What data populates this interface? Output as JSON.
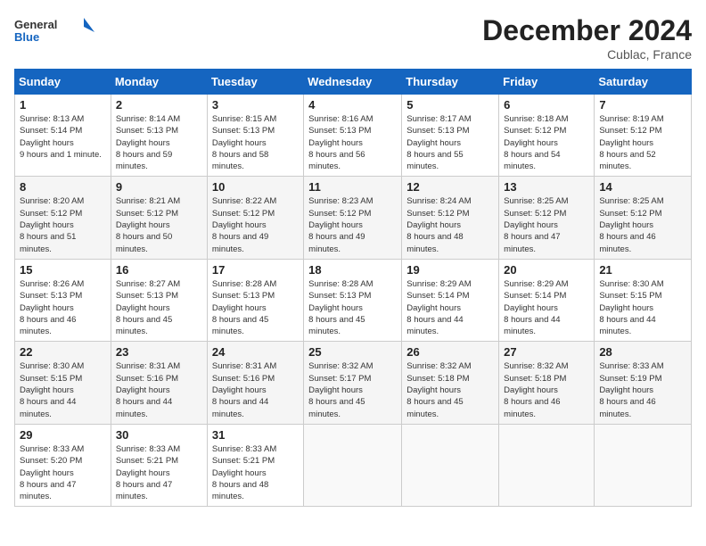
{
  "header": {
    "logo_line1": "General",
    "logo_line2": "Blue",
    "month_title": "December 2024",
    "location": "Cublac, France"
  },
  "weekdays": [
    "Sunday",
    "Monday",
    "Tuesday",
    "Wednesday",
    "Thursday",
    "Friday",
    "Saturday"
  ],
  "weeks": [
    [
      {
        "day": "1",
        "sunrise": "8:13 AM",
        "sunset": "5:14 PM",
        "daylight": "9 hours and 1 minute."
      },
      {
        "day": "2",
        "sunrise": "8:14 AM",
        "sunset": "5:13 PM",
        "daylight": "8 hours and 59 minutes."
      },
      {
        "day": "3",
        "sunrise": "8:15 AM",
        "sunset": "5:13 PM",
        "daylight": "8 hours and 58 minutes."
      },
      {
        "day": "4",
        "sunrise": "8:16 AM",
        "sunset": "5:13 PM",
        "daylight": "8 hours and 56 minutes."
      },
      {
        "day": "5",
        "sunrise": "8:17 AM",
        "sunset": "5:13 PM",
        "daylight": "8 hours and 55 minutes."
      },
      {
        "day": "6",
        "sunrise": "8:18 AM",
        "sunset": "5:12 PM",
        "daylight": "8 hours and 54 minutes."
      },
      {
        "day": "7",
        "sunrise": "8:19 AM",
        "sunset": "5:12 PM",
        "daylight": "8 hours and 52 minutes."
      }
    ],
    [
      {
        "day": "8",
        "sunrise": "8:20 AM",
        "sunset": "5:12 PM",
        "daylight": "8 hours and 51 minutes."
      },
      {
        "day": "9",
        "sunrise": "8:21 AM",
        "sunset": "5:12 PM",
        "daylight": "8 hours and 50 minutes."
      },
      {
        "day": "10",
        "sunrise": "8:22 AM",
        "sunset": "5:12 PM",
        "daylight": "8 hours and 49 minutes."
      },
      {
        "day": "11",
        "sunrise": "8:23 AM",
        "sunset": "5:12 PM",
        "daylight": "8 hours and 49 minutes."
      },
      {
        "day": "12",
        "sunrise": "8:24 AM",
        "sunset": "5:12 PM",
        "daylight": "8 hours and 48 minutes."
      },
      {
        "day": "13",
        "sunrise": "8:25 AM",
        "sunset": "5:12 PM",
        "daylight": "8 hours and 47 minutes."
      },
      {
        "day": "14",
        "sunrise": "8:25 AM",
        "sunset": "5:12 PM",
        "daylight": "8 hours and 46 minutes."
      }
    ],
    [
      {
        "day": "15",
        "sunrise": "8:26 AM",
        "sunset": "5:13 PM",
        "daylight": "8 hours and 46 minutes."
      },
      {
        "day": "16",
        "sunrise": "8:27 AM",
        "sunset": "5:13 PM",
        "daylight": "8 hours and 45 minutes."
      },
      {
        "day": "17",
        "sunrise": "8:28 AM",
        "sunset": "5:13 PM",
        "daylight": "8 hours and 45 minutes."
      },
      {
        "day": "18",
        "sunrise": "8:28 AM",
        "sunset": "5:13 PM",
        "daylight": "8 hours and 45 minutes."
      },
      {
        "day": "19",
        "sunrise": "8:29 AM",
        "sunset": "5:14 PM",
        "daylight": "8 hours and 44 minutes."
      },
      {
        "day": "20",
        "sunrise": "8:29 AM",
        "sunset": "5:14 PM",
        "daylight": "8 hours and 44 minutes."
      },
      {
        "day": "21",
        "sunrise": "8:30 AM",
        "sunset": "5:15 PM",
        "daylight": "8 hours and 44 minutes."
      }
    ],
    [
      {
        "day": "22",
        "sunrise": "8:30 AM",
        "sunset": "5:15 PM",
        "daylight": "8 hours and 44 minutes."
      },
      {
        "day": "23",
        "sunrise": "8:31 AM",
        "sunset": "5:16 PM",
        "daylight": "8 hours and 44 minutes."
      },
      {
        "day": "24",
        "sunrise": "8:31 AM",
        "sunset": "5:16 PM",
        "daylight": "8 hours and 44 minutes."
      },
      {
        "day": "25",
        "sunrise": "8:32 AM",
        "sunset": "5:17 PM",
        "daylight": "8 hours and 45 minutes."
      },
      {
        "day": "26",
        "sunrise": "8:32 AM",
        "sunset": "5:18 PM",
        "daylight": "8 hours and 45 minutes."
      },
      {
        "day": "27",
        "sunrise": "8:32 AM",
        "sunset": "5:18 PM",
        "daylight": "8 hours and 46 minutes."
      },
      {
        "day": "28",
        "sunrise": "8:33 AM",
        "sunset": "5:19 PM",
        "daylight": "8 hours and 46 minutes."
      }
    ],
    [
      {
        "day": "29",
        "sunrise": "8:33 AM",
        "sunset": "5:20 PM",
        "daylight": "8 hours and 47 minutes."
      },
      {
        "day": "30",
        "sunrise": "8:33 AM",
        "sunset": "5:21 PM",
        "daylight": "8 hours and 47 minutes."
      },
      {
        "day": "31",
        "sunrise": "8:33 AM",
        "sunset": "5:21 PM",
        "daylight": "8 hours and 48 minutes."
      },
      null,
      null,
      null,
      null
    ]
  ]
}
